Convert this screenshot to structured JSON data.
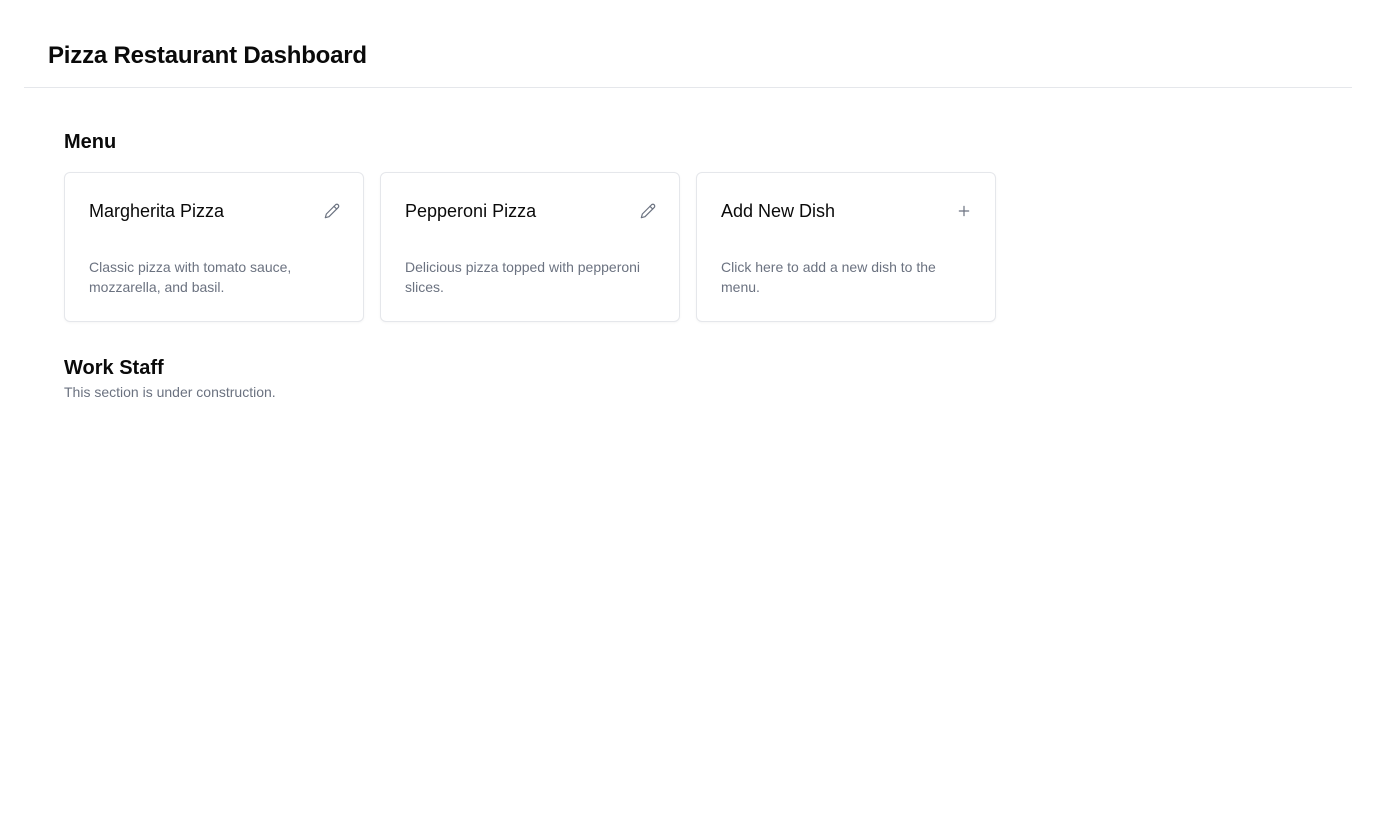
{
  "header": {
    "title": "Pizza Restaurant Dashboard"
  },
  "menu": {
    "title": "Menu",
    "items": [
      {
        "name": "Margherita Pizza",
        "description": "Classic pizza with tomato sauce, mozzarella, and basil.",
        "action_icon": "pencil-icon"
      },
      {
        "name": "Pepperoni Pizza",
        "description": "Delicious pizza topped with pepperoni slices.",
        "action_icon": "pencil-icon"
      },
      {
        "name": "Add New Dish",
        "description": "Click here to add a new dish to the menu.",
        "action_icon": "plus-icon"
      }
    ]
  },
  "staff": {
    "title": "Work Staff",
    "description": "This section is under construction."
  },
  "colors": {
    "text": "#0a0a0a",
    "muted": "#6b7280",
    "border": "#e5e7eb",
    "background": "#ffffff"
  }
}
